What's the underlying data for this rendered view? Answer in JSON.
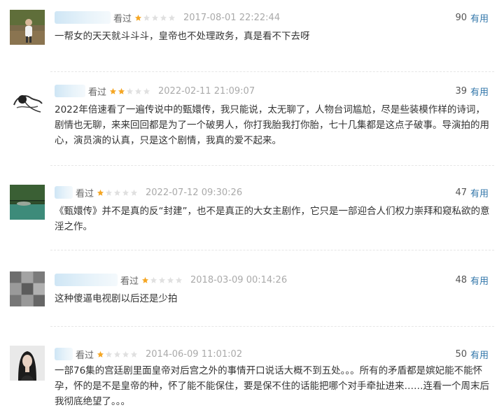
{
  "comments": [
    {
      "watched": "看过",
      "rating": 1,
      "date": "2017-08-01 22:22:44",
      "votes": "90",
      "vote_label": "有用",
      "text": "一帮女的天天就斗斗斗，皇帝也不处理政务，真是看不下去呀"
    },
    {
      "watched": "看过",
      "rating": 2,
      "date": "2022-02-11 21:09:07",
      "votes": "39",
      "vote_label": "有用",
      "text": "2022年倍速看了一遍传说中的甄嬛传，我只能说，太无聊了，人物台词尴尬，尽是些装模作样的诗词，剧情也无聊，来来回回都是为了一个破男人，你打我胎我打你胎，七十几集都是这点子破事。导演拍的用心，演员演的认真，只是这个剧情，我真的爱不起来。"
    },
    {
      "watched": "看过",
      "rating": 1,
      "date": "2022-07-12 09:30:26",
      "votes": "47",
      "vote_label": "有用",
      "text": "《甄嬛传》并不是真的反“封建”，也不是真正的大女主剧作，它只是一部迎合人们权力崇拜和窥私欲的意淫之作。"
    },
    {
      "watched": "看过",
      "rating": 1,
      "date": "2018-03-09 00:14:26",
      "votes": "48",
      "vote_label": "有用",
      "text": "这种傻逼电视剧以后还是少拍"
    },
    {
      "watched": "看过",
      "rating": 1,
      "date": "2014-06-09 11:01:02",
      "votes": "50",
      "vote_label": "有用",
      "text": "一部76集的宫廷剧里面皇帝对后宫之外的事情开口说话大概不到五处。。。所有的矛盾都是嫔妃能不能怀孕，怀的是不是皇帝的种，怀了能不能保住，要是保不住的话能把哪个对手牵扯进来……连看一个周末后我彻底绝望了。。。"
    }
  ],
  "colors": {
    "star_on": "#f5a623",
    "star_off": "#e0e0e0",
    "vote_link": "#3377aa"
  }
}
